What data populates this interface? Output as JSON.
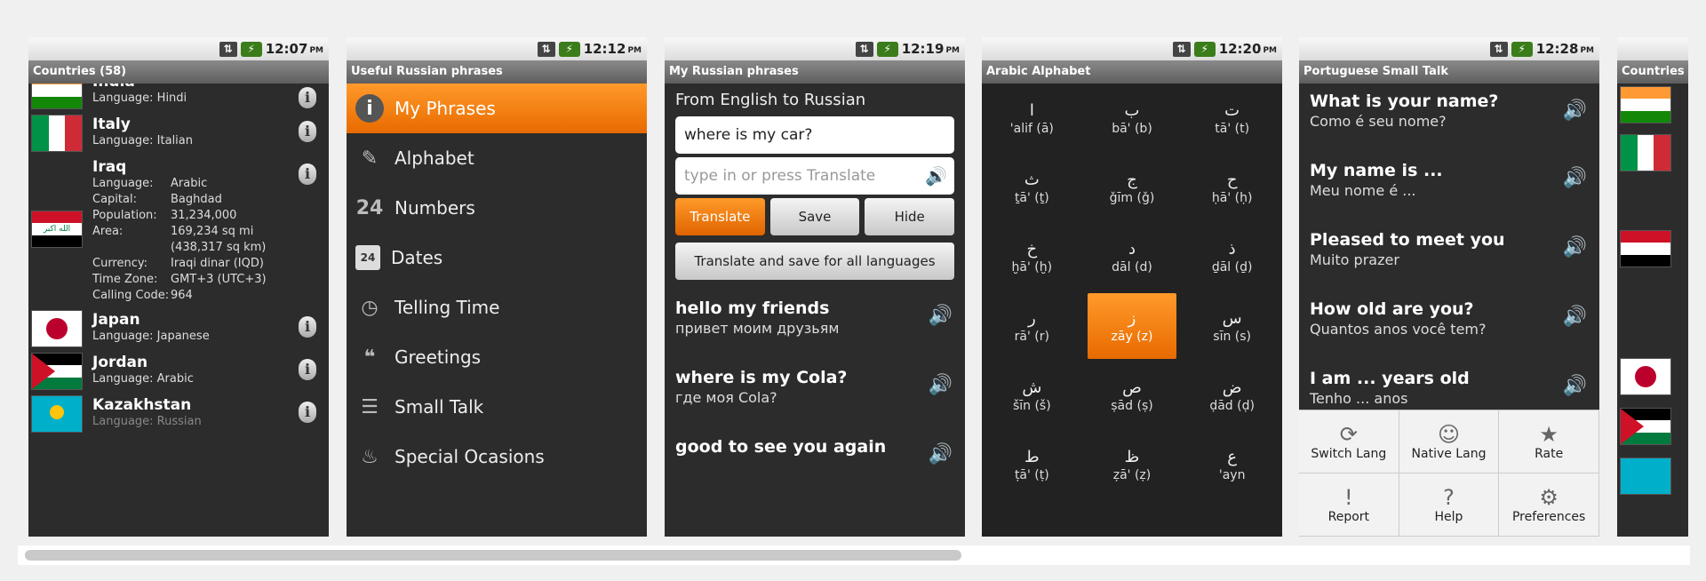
{
  "screens": [
    {
      "time": "12:07",
      "pm": "PM",
      "title": "Countries (58)"
    },
    {
      "time": "12:12",
      "pm": "PM",
      "title": "Useful Russian phrases"
    },
    {
      "time": "12:19",
      "pm": "PM",
      "title": "My Russian phrases"
    },
    {
      "time": "12:20",
      "pm": "PM",
      "title": "Arabic Alphabet"
    },
    {
      "time": "12:28",
      "pm": "PM",
      "title": "Portuguese Small Talk"
    },
    {
      "title": "Countries"
    }
  ],
  "countries": {
    "india_partial": {
      "name": "India",
      "lang": "Language: Hindi"
    },
    "italy": {
      "name": "Italy",
      "lang": "Language: Italian"
    },
    "iraq": {
      "name": "Iraq",
      "details": [
        [
          "Language:",
          "Arabic"
        ],
        [
          "Capital:",
          "Baghdad"
        ],
        [
          "Population:",
          "31,234,000"
        ],
        [
          "Area:",
          "169,234 sq mi"
        ],
        [
          "",
          "(438,317 sq km)"
        ],
        [
          "Currency:",
          "Iraqi dinar (IQD)"
        ],
        [
          "Time Zone:",
          "GMT+3 (UTC+3)"
        ],
        [
          "Calling Code:",
          "964"
        ]
      ]
    },
    "japan": {
      "name": "Japan",
      "lang": "Language: Japanese"
    },
    "jordan": {
      "name": "Jordan",
      "lang": "Language: Arabic"
    },
    "kazakhstan": {
      "name": "Kazakhstan",
      "lang": "Language: Russian"
    },
    "info_glyph": "i"
  },
  "menu": [
    {
      "label": "My Phrases",
      "icon": "info-icon",
      "glyph": "i"
    },
    {
      "label": "Alphabet",
      "icon": "quill-icon",
      "glyph": "✎"
    },
    {
      "label": "Numbers",
      "icon": "numbers-icon",
      "glyph": "24"
    },
    {
      "label": "Dates",
      "icon": "calendar-icon",
      "glyph": "24"
    },
    {
      "label": "Telling Time",
      "icon": "clock-icon",
      "glyph": "◷"
    },
    {
      "label": "Greetings",
      "icon": "chat-bubbles-icon",
      "glyph": "❝"
    },
    {
      "label": "Small Talk",
      "icon": "speech-icon",
      "glyph": "☰"
    },
    {
      "label": "Special Ocasions",
      "icon": "cake-icon",
      "glyph": "♨"
    }
  ],
  "translator": {
    "label": "From English to Russian",
    "input_value": "where is my car?",
    "output_placeholder": "type in or press Translate",
    "translate": "Translate",
    "save": "Save",
    "hide": "Hide",
    "translate_all": "Translate and save for all languages",
    "phrases": [
      {
        "en": "hello my friends",
        "ru": "привет моим друзьям"
      },
      {
        "en": "where is my Cola?",
        "ru": "где моя Cola?"
      },
      {
        "en": "good to see you again",
        "ru": ""
      }
    ]
  },
  "alphabet": [
    {
      "g": "ا",
      "t": "'alif (ā)"
    },
    {
      "g": "ب",
      "t": "bā' (b)"
    },
    {
      "g": "ت",
      "t": "tā' (t)"
    },
    {
      "g": "ث",
      "t": "ṯā' (ṯ)"
    },
    {
      "g": "ج",
      "t": "ǧīm (ǧ)"
    },
    {
      "g": "ح",
      "t": "ḥā' (ḥ)"
    },
    {
      "g": "خ",
      "t": "ḫā' (ḫ)"
    },
    {
      "g": "د",
      "t": "dāl (d)"
    },
    {
      "g": "ذ",
      "t": "ḏāl (ḏ)"
    },
    {
      "g": "ر",
      "t": "rā' (r)"
    },
    {
      "g": "ز",
      "t": "zāy (z)"
    },
    {
      "g": "س",
      "t": "sīn (s)"
    },
    {
      "g": "ش",
      "t": "šīn (š)"
    },
    {
      "g": "ص",
      "t": "ṣād (ṣ)"
    },
    {
      "g": "ض",
      "t": "ḍād (ḍ)"
    },
    {
      "g": "ط",
      "t": "ṭā' (ṭ)"
    },
    {
      "g": "ظ",
      "t": "ẓā' (ẓ)"
    },
    {
      "g": "ع",
      "t": "'ayn"
    }
  ],
  "smalltalk": [
    {
      "q": "What is your name?",
      "a": "Como é seu nome?"
    },
    {
      "q": "My name is ...",
      "a": "Meu nome é ..."
    },
    {
      "q": "Pleased to meet you",
      "a": "Muito prazer"
    },
    {
      "q": "How old are you?",
      "a": "Quantos anos você tem?"
    },
    {
      "q": "I am ... years old",
      "a": "Tenho ... anos"
    }
  ],
  "options": [
    {
      "label": "Switch Lang",
      "icon": "refresh-icon",
      "glyph": "⟳"
    },
    {
      "label": "Native Lang",
      "icon": "smiley-icon",
      "glyph": "☺"
    },
    {
      "label": "Rate",
      "icon": "star-icon",
      "glyph": "★"
    },
    {
      "label": "Report",
      "icon": "report-icon",
      "glyph": "!"
    },
    {
      "label": "Help",
      "icon": "help-icon",
      "glyph": "?"
    },
    {
      "label": "Preferences",
      "icon": "preferences-icon",
      "glyph": "⚙"
    }
  ],
  "speaker_glyph": "🔊",
  "status_icons": {
    "signal": "⇅",
    "battery": "⚡"
  }
}
